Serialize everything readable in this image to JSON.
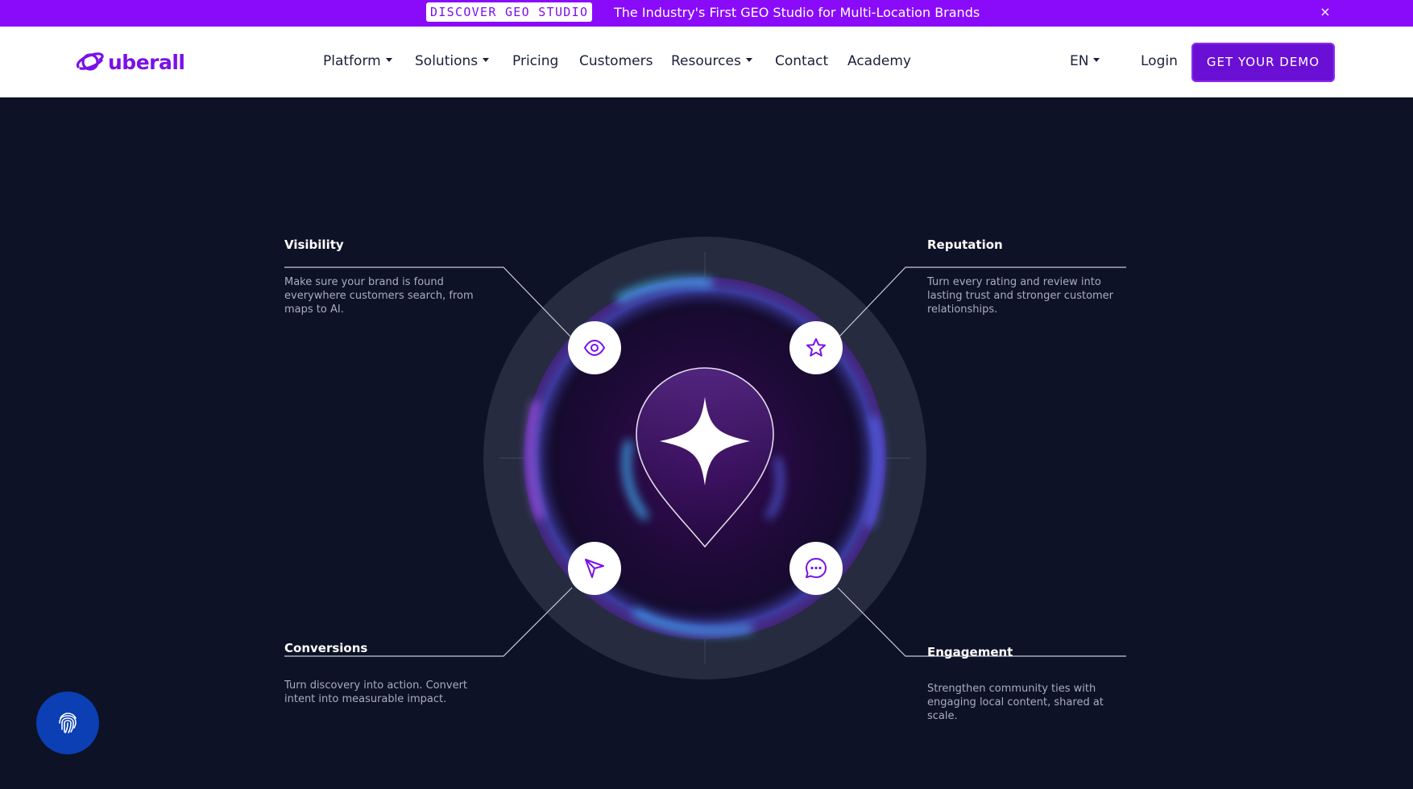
{
  "announcement": {
    "badge": "DISCOVER GEO STUDIO",
    "text": "The Industry's First GEO Studio for Multi-Location Brands",
    "close": "×"
  },
  "header": {
    "logo_text": "uberall",
    "nav": [
      {
        "label": "Platform",
        "dropdown": true
      },
      {
        "label": "Solutions",
        "dropdown": true
      },
      {
        "label": "Pricing",
        "dropdown": false
      },
      {
        "label": "Customers",
        "dropdown": false
      },
      {
        "label": "Resources",
        "dropdown": true
      },
      {
        "label": "Contact",
        "dropdown": false
      },
      {
        "label": "Academy",
        "dropdown": false
      }
    ],
    "language": "EN",
    "login": "Login",
    "demo_button": "GET YOUR DEMO"
  },
  "features": {
    "visibility": {
      "title": "Visibility",
      "description": "Make sure your brand is found everywhere customers search, from maps to AI.",
      "icon": "eye-icon"
    },
    "reputation": {
      "title": "Reputation",
      "description": "Turn every rating and review into lasting trust and stronger customer relationships.",
      "icon": "star-icon"
    },
    "conversions": {
      "title": "Conversions",
      "description": "Turn discovery into action. Convert intent into measurable impact.",
      "icon": "cursor-arrow-icon"
    },
    "engagement": {
      "title": "Engagement",
      "description": "Strengthen community ties with engaging local content, shared at scale.",
      "icon": "chat-bubble-icon"
    }
  },
  "center_icon": "sparkle-pin-icon",
  "floating_button_icon": "fingerprint-icon",
  "colors": {
    "brand": "#8a0bf9",
    "brand_dark": "#6a0fd4",
    "background": "#0d1226",
    "text_muted": "#a9adbd"
  }
}
